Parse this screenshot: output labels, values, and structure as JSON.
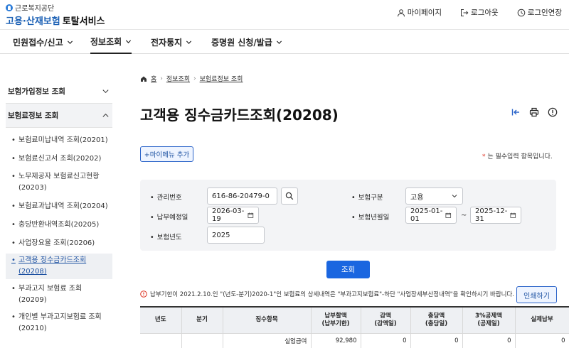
{
  "header": {
    "org_name": "근로복지공단",
    "brand": "고용·산재보험",
    "service": "토탈서비스",
    "util": [
      {
        "label": "마이페이지",
        "icon": "person-icon"
      },
      {
        "label": "로그아웃",
        "icon": "logout-icon"
      },
      {
        "label": "로그인연장",
        "icon": "clock-icon"
      }
    ]
  },
  "gnb": [
    {
      "label": "민원접수/신고"
    },
    {
      "label": "정보조회"
    },
    {
      "label": "전자통지"
    },
    {
      "label": "증명원 신청/발급"
    }
  ],
  "sidebar": {
    "groups": [
      {
        "label": "보험가입정보 조회"
      },
      {
        "label": "보험료정보 조회"
      }
    ],
    "items": [
      {
        "label": "보험료미납내역 조회(20201)"
      },
      {
        "label": "보험료신고서 조회(20202)"
      },
      {
        "label": "노무제공자 보험료신고현황",
        "label2": "(20203)"
      },
      {
        "label": "보험료과납내역 조회(20204)"
      },
      {
        "label": "충당반환내역조회(20205)"
      },
      {
        "label": "사업장요율 조회(20206)"
      },
      {
        "label": "고객용 징수금카드조회",
        "label2": "(20208)"
      },
      {
        "label": "부과고지 보험료 조회",
        "label2": "(20209)"
      },
      {
        "label": "개인별 부과고지보험료 조회",
        "label2": "(20210)"
      }
    ]
  },
  "breadcrumb": {
    "home": "홈",
    "level1": "정보조회",
    "level2": "보험료정보 조회"
  },
  "page_title": "고객용 징수금카드조회(20208)",
  "mymenu_button": "+마이메뉴 추가",
  "required_note": {
    "star": "*",
    "text": " 는 필수입력 항목입니다."
  },
  "form": {
    "mgmt_no": {
      "label": "관리번호",
      "value": "616-86-20479-0"
    },
    "insurance_type": {
      "label": "보험구분",
      "value": "고용"
    },
    "due_date": {
      "label": "납부예정일",
      "value": "2026-03-19"
    },
    "period": {
      "label": "보험년월일",
      "from": "2025-01-01",
      "to": "2025-12-31",
      "sep": "~"
    },
    "year": {
      "label": "보험년도",
      "value": "2025"
    }
  },
  "query_button": "조회",
  "notice": "납부기한이 2021.2.10.인 \"(년도-분기)2020-1\"인 보험료의 상세내역은 \"부과고지보험료\"-하단 \"사업장세부산정내역\"을 확인하시기 바랍니다.",
  "print_button": "인쇄하기",
  "table": {
    "headers": [
      {
        "l1": "년도",
        "l2": ""
      },
      {
        "l1": "분기",
        "l2": ""
      },
      {
        "l1": "징수항목",
        "l2": ""
      },
      {
        "l1": "납부할액",
        "l2": "(납부기한)"
      },
      {
        "l1": "감액",
        "l2": "(감액일)"
      },
      {
        "l1": "충당액",
        "l2": "(충당일)"
      },
      {
        "l1": "3%공제액",
        "l2": "(공제일)"
      },
      {
        "l1": "실제납부",
        "l2": ""
      }
    ],
    "rows": [
      [
        "",
        "",
        "실업급여",
        "92,980",
        "0",
        "0",
        "0",
        "0"
      ]
    ]
  }
}
